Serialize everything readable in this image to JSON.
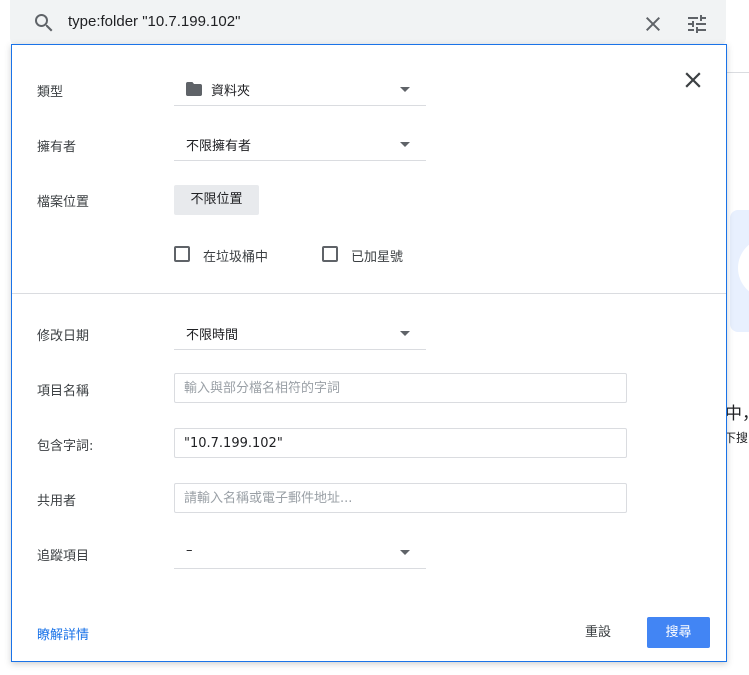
{
  "search": {
    "query": "type:folder \"10.7.199.102\""
  },
  "panel": {
    "type": {
      "label": "類型",
      "value": "資料夾"
    },
    "owner": {
      "label": "擁有者",
      "value": "不限擁有者"
    },
    "location": {
      "label": "檔案位置",
      "chip": "不限位置"
    },
    "checkboxes": {
      "trash": {
        "label": "在垃圾桶中",
        "checked": false
      },
      "starred": {
        "label": "已加星號",
        "checked": false
      }
    },
    "modified": {
      "label": "修改日期",
      "value": "不限時間"
    },
    "item_name": {
      "label": "項目名稱",
      "placeholder": "輸入與部分檔名相符的字詞",
      "value": ""
    },
    "includes_words": {
      "label": "包含字詞:",
      "value": "\"10.7.199.102\""
    },
    "shared_with": {
      "label": "共用者",
      "placeholder": "請輸入名稱或電子郵件地址...",
      "value": ""
    },
    "follow_up": {
      "label": "追蹤項目",
      "value": "–"
    },
    "footer": {
      "learn_more": "瞭解詳情",
      "reset": "重設",
      "search": "搜尋"
    }
  },
  "background": {
    "text1": "中，",
    "text2": "下搜"
  },
  "colors": {
    "accent": "#1a73e8",
    "search_button": "#4285f4",
    "searchbar_bg": "#f1f3f4",
    "chip_bg": "#e8eaed"
  },
  "icons": {
    "search": "search-icon",
    "clear": "close-icon",
    "tune": "tune-icon",
    "close": "close-icon",
    "folder": "folder-icon",
    "dropdown": "caret-down-icon"
  }
}
